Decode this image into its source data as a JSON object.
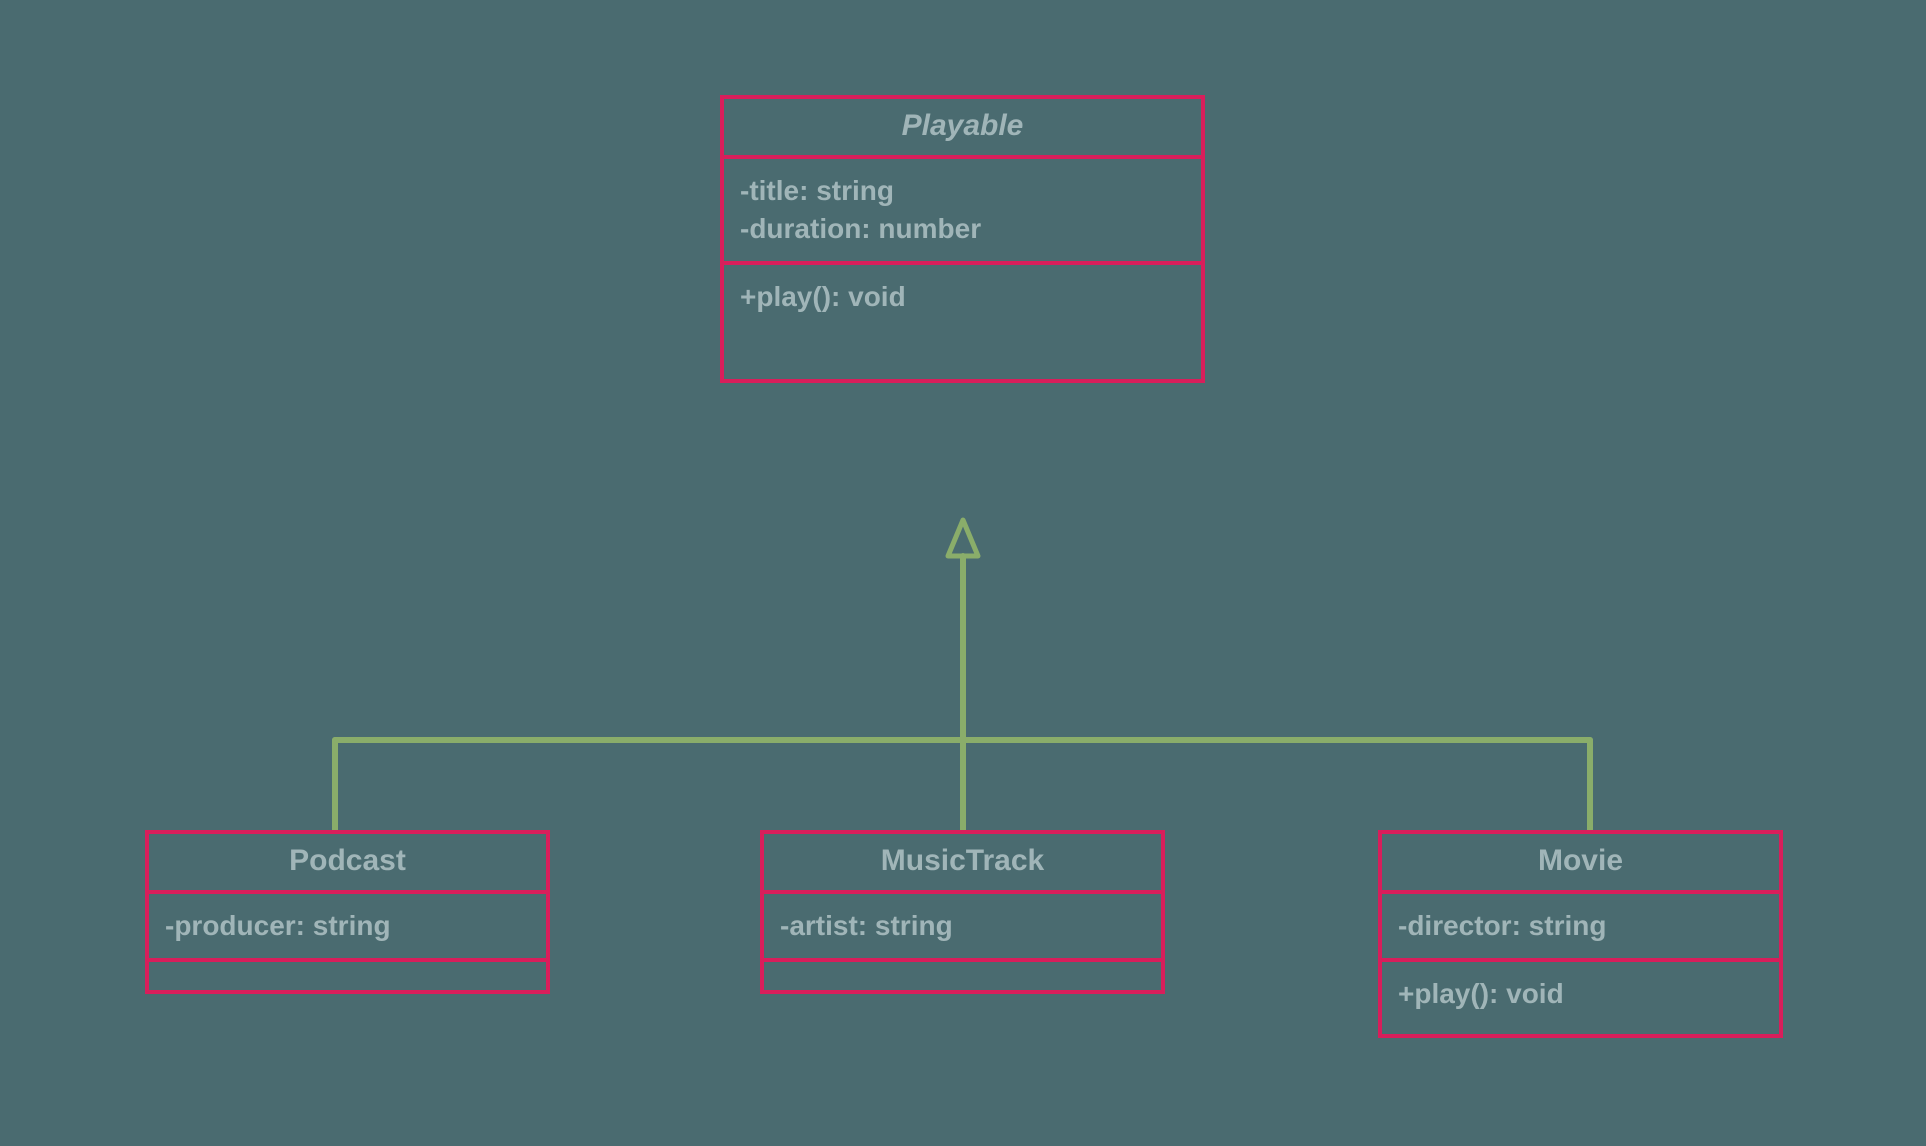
{
  "diagram": {
    "parent": {
      "name": "Playable",
      "abstract": true,
      "attrs": [
        "-title: string",
        "-duration: number"
      ],
      "methods": [
        "+play(): void"
      ]
    },
    "children": [
      {
        "name": "Podcast",
        "attrs": [
          "-producer: string"
        ],
        "methods": []
      },
      {
        "name": "MusicTrack",
        "attrs": [
          "-artist: string"
        ],
        "methods": []
      },
      {
        "name": "Movie",
        "attrs": [
          "-director: string"
        ],
        "methods": [
          "+play(): void"
        ]
      }
    ],
    "colors": {
      "background": "#4a6b70",
      "border": "#d81e5b",
      "text": "#a0b5b8",
      "connector": "#8aad6a"
    }
  }
}
